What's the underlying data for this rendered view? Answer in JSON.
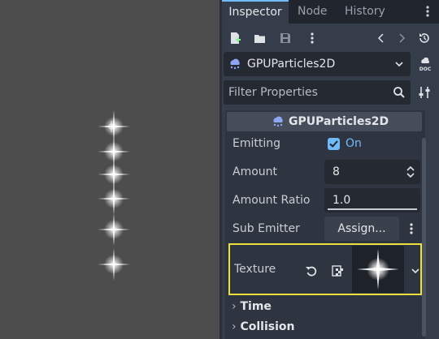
{
  "tabs": [
    {
      "label": "Inspector",
      "active": true
    },
    {
      "label": "Node",
      "active": false
    },
    {
      "label": "History",
      "active": false
    }
  ],
  "toolbar": {
    "icons": [
      "new-resource-icon",
      "open-icon",
      "save-icon",
      "more-icon",
      "back-icon",
      "forward-icon",
      "history-icon"
    ]
  },
  "node_selector": {
    "value": "GPUParticles2D",
    "doc_label": "DOC"
  },
  "filter": {
    "placeholder": "Filter Properties"
  },
  "section": {
    "title": "GPUParticles2D",
    "emitting": {
      "label": "Emitting",
      "checked": true,
      "value": "On"
    },
    "amount": {
      "label": "Amount",
      "value": "8"
    },
    "amount_ratio": {
      "label": "Amount Ratio",
      "value": "1.0",
      "slider_level": 1.0
    },
    "sub_emitter": {
      "label": "Sub Emitter",
      "button": "Assign..."
    },
    "texture": {
      "label": "Texture"
    },
    "groups": [
      {
        "label": "Time"
      },
      {
        "label": "Collision"
      }
    ]
  },
  "colors": {
    "accent": "#70bafa",
    "highlight": "#ece03d",
    "checkbox": "#70bafa"
  }
}
